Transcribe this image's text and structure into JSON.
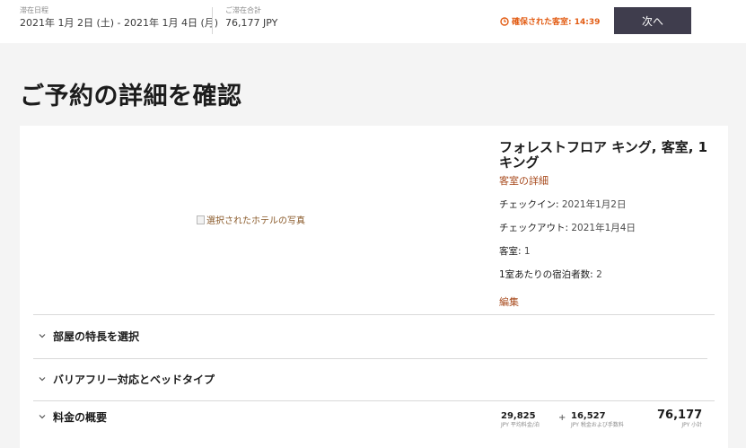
{
  "topbar": {
    "stay_dates_label": "滞在日程",
    "stay_dates_value": "2021年 1月 2日 (土) - 2021年 1月 4日 (月)",
    "stay_total_label": "ご滞在合計",
    "stay_total_value": "76,177 JPY",
    "timer_text": "確保された客室: 14:39",
    "next_label": "次へ"
  },
  "page": {
    "title": "ご予約の詳細を確認"
  },
  "room": {
    "photo_alt": "選択されたホテルの写真",
    "name": "フォレストフロア キング, 客室, 1 キング",
    "details_link": "客室の詳細",
    "checkin_label": "チェックイン: ",
    "checkin_value": "2021年1月2日",
    "checkout_label": "チェックアウト: ",
    "checkout_value": "2021年1月4日",
    "rooms_label": "客室: ",
    "rooms_value": "1",
    "guests_label": "1室あたりの宿泊者数: ",
    "guests_value": "2",
    "edit_link": "編集"
  },
  "sections": {
    "features": "部屋の特長を選択",
    "accessibility": "バリアフリー対応とベッドタイプ",
    "price_summary": "料金の概要"
  },
  "price": {
    "avg_rate_value": "29,825",
    "avg_rate_caption": "JPY 平均料金/泊",
    "plus": "+",
    "tax_value": "16,527",
    "tax_caption": "JPY 税金および手数料",
    "subtotal_value": "76,177",
    "subtotal_caption": "JPY 小計"
  },
  "colors": {
    "accent": "#a84b1e",
    "timer": "#e25b12",
    "button_bg": "#3f3d4d",
    "page_bg": "#f4f4f4"
  },
  "icons": {
    "timer": "clock-icon",
    "accordion": "chevron-down-icon",
    "photo": "broken-image-icon"
  }
}
